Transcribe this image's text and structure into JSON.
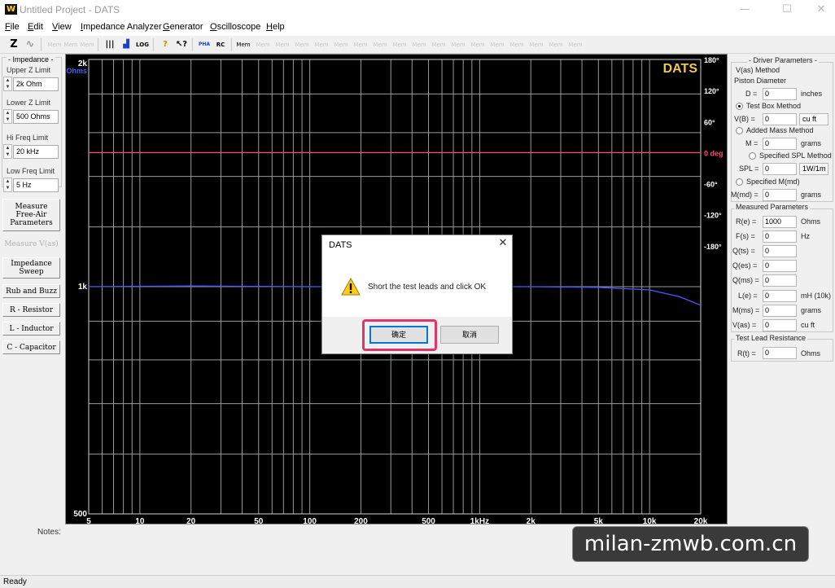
{
  "window": {
    "title": "Untitled Project - DATS",
    "logo_text": "W",
    "controls": [
      "—",
      "☐",
      "✕"
    ]
  },
  "menu": [
    "File",
    "Edit",
    "View",
    "Impedance Analyzer",
    "Generator",
    "Oscilloscope",
    "Help"
  ],
  "toolbar": {
    "buttons": [
      "Z",
      "∿",
      "|||",
      "▟",
      "LOG",
      "?",
      "↖?",
      "PHA",
      "RC",
      "Mem"
    ],
    "disabled_label": "Mem"
  },
  "left_panel": {
    "group_title": "- Impedance -",
    "fields": [
      {
        "label": "Upper Z Limit",
        "value": "2k Ohm"
      },
      {
        "label": "Lower Z Limit",
        "value": "500 Ohms"
      },
      {
        "label": "Hi Freq Limit",
        "value": "20 kHz"
      },
      {
        "label": "Low Freq Limit",
        "value": "5 Hz"
      }
    ],
    "buttons": [
      {
        "label": "Measure\nFree-Air\nParameters",
        "enabled": true
      },
      {
        "label": "Measure V(as)",
        "enabled": false
      },
      {
        "label": "Impedance\nSweep",
        "enabled": true
      },
      {
        "label": "Rub and Buzz",
        "enabled": true
      },
      {
        "label": "R - Resistor",
        "enabled": true
      },
      {
        "label": "L - Inductor",
        "enabled": true
      },
      {
        "label": "C - Capacitor",
        "enabled": true
      }
    ]
  },
  "chart_data": {
    "type": "line",
    "brand": "DATS",
    "x_scale": "log",
    "xlim": [
      5,
      20000
    ],
    "x_ticks": [
      "5",
      "10",
      "20",
      "50",
      "100",
      "200",
      "500",
      "1kHz",
      "2k",
      "5k",
      "10k",
      "20k"
    ],
    "x_tick_values": [
      5,
      10,
      20,
      50,
      100,
      200,
      500,
      1000,
      2000,
      5000,
      10000,
      20000
    ],
    "y_left_ticks": [
      "2k",
      "1k",
      "500"
    ],
    "y_left_unit": "Ohms",
    "y_left_scale": "log",
    "ylim_left": [
      500,
      2000
    ],
    "y_right_ticks": [
      "180°",
      "120°",
      "60°",
      "0 deg",
      "-60°",
      "-120°",
      "-180°"
    ],
    "y_right_values": [
      180,
      120,
      60,
      0,
      -60,
      -120,
      -180
    ],
    "series": [
      {
        "type": "impedance",
        "color": "#4a5cff",
        "x": [
          5,
          20,
          100,
          500,
          1000,
          2000,
          5000,
          10000,
          15000,
          20000
        ],
        "y": [
          1000,
          1002,
          1000,
          1000,
          1000,
          1000,
          998,
          990,
          970,
          945
        ]
      },
      {
        "type": "phase",
        "color": "#ff4b6e",
        "x": [
          5,
          20,
          100,
          1000,
          5000,
          20000
        ],
        "y": [
          0,
          0,
          0,
          0,
          0,
          0
        ]
      }
    ],
    "colors": {
      "background": "#000000",
      "grid": "#9a9a9a",
      "brand": "#f2c84b",
      "phase_label": "#ff4b6e",
      "ohms_label": "#4a5cff"
    }
  },
  "right_panel": {
    "title": "- Driver Parameters -",
    "vas_method": "V(as) Method",
    "piston": "Piston Diameter",
    "d_label": "D =",
    "d_value": "0",
    "d_unit": "inches",
    "test_box": "Test Box Method",
    "vb_label": "V(B) =",
    "vb_value": "0",
    "vb_unit": "cu ft",
    "added_mass": "Added Mass Method",
    "m_label": "M =",
    "m_value": "0",
    "m_unit": "grams",
    "spl_method": "Specified SPL Method",
    "spl_label": "SPL =",
    "spl_value": "0",
    "spl_unit": "1W/1m",
    "mmd_method": "Specified M(md)",
    "mmd_label": "M(md) =",
    "mmd_value": "0",
    "mmd_unit": "grams",
    "measured_title": "Measured Parameters",
    "measured": [
      {
        "label": "R(e) =",
        "value": "1000",
        "unit": "Ohms"
      },
      {
        "label": "F(s) =",
        "value": "0",
        "unit": "Hz"
      },
      {
        "label": "Q(ts) =",
        "value": "0",
        "unit": ""
      },
      {
        "label": "Q(es) =",
        "value": "0",
        "unit": ""
      },
      {
        "label": "Q(ms) =",
        "value": "0",
        "unit": ""
      },
      {
        "label": "L(e) =",
        "value": "0",
        "unit": "mH (10k)"
      },
      {
        "label": "M(ms) =",
        "value": "0",
        "unit": "grams"
      },
      {
        "label": "V(as) =",
        "value": "0",
        "unit": "cu ft"
      }
    ],
    "lead_title": "Test Lead Resistance",
    "rt_label": "R(t) =",
    "rt_value": "0",
    "rt_unit": "Ohms"
  },
  "notes_label": "Notes:",
  "status": "Ready",
  "dialog": {
    "title": "DATS",
    "message": "Short the test leads and click OK",
    "ok": "确定",
    "cancel": "取消"
  },
  "watermark": "milan-zmwb.com.cn"
}
